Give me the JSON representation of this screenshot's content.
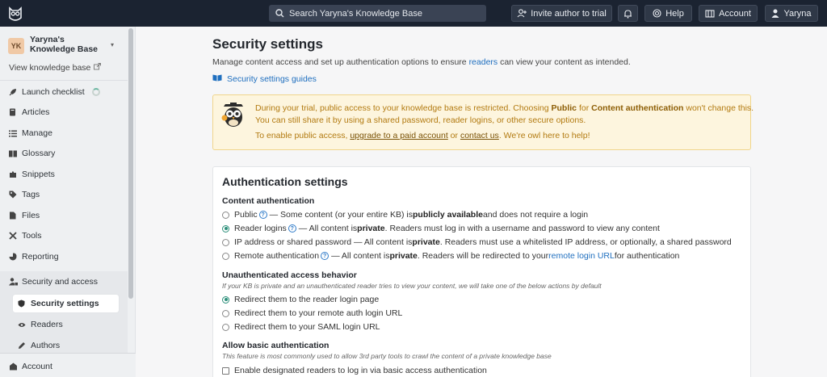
{
  "topbar": {
    "search_placeholder": "Search Yaryna's Knowledge Base",
    "invite_label": "Invite author to trial",
    "help_label": "Help",
    "account_label": "Account",
    "user_label": "Yaryna",
    "icons": [
      "owl-logo-icon",
      "search-icon",
      "add-user-icon",
      "bell-icon",
      "help-icon",
      "account-icon",
      "user-icon"
    ]
  },
  "sidebar": {
    "kb_initials": "YK",
    "kb_name": "Yaryna's Knowledge Base",
    "view_kb": "View knowledge base",
    "items": [
      {
        "label": "Launch checklist",
        "icon": "rocket-icon"
      },
      {
        "label": "Articles",
        "icon": "book-icon"
      },
      {
        "label": "Manage",
        "icon": "list-icon"
      },
      {
        "label": "Glossary",
        "icon": "glossary-icon"
      },
      {
        "label": "Snippets",
        "icon": "puzzle-icon"
      },
      {
        "label": "Tags",
        "icon": "tag-icon"
      },
      {
        "label": "Files",
        "icon": "file-icon"
      },
      {
        "label": "Tools",
        "icon": "tools-icon"
      },
      {
        "label": "Reporting",
        "icon": "chart-icon"
      }
    ],
    "section": {
      "label": "Security and access",
      "subitems": [
        {
          "label": "Security settings",
          "active": true
        },
        {
          "label": "Readers",
          "active": false
        },
        {
          "label": "Authors",
          "active": false
        }
      ]
    },
    "footer_account": "Account"
  },
  "main": {
    "title": "Security settings",
    "desc_before": "Manage content access and set up authentication options to ensure ",
    "desc_link": "readers",
    "desc_after": " can view your content as intended.",
    "guides_label": "Security settings guides",
    "notice": {
      "l1a": "During your trial, public access to your knowledge base is restricted. Choosing ",
      "l1b": "Public",
      "l1c": " for ",
      "l1d": "Content authentication",
      "l1e": " won't change this.",
      "l2": "You can still share it by using a shared password, reader logins, or other secure options.",
      "l3a": "To enable public access, ",
      "l3b": "upgrade to a paid account",
      "l3c": " or ",
      "l3d": "contact us",
      "l3e": ". We're owl here to help!"
    },
    "card": {
      "title": "Authentication settings",
      "content_auth_title": "Content authentication",
      "opt_public_a": "Public",
      "opt_public_b": " — Some content (or your entire KB) is ",
      "opt_public_c": "publicly available",
      "opt_public_d": " and does not require a login",
      "opt_reader_a": "Reader logins",
      "opt_reader_b": " — All content is ",
      "opt_reader_c": "private",
      "opt_reader_d": ". Readers must log in with a username and password to view any content",
      "opt_ip_a": "IP address or shared password — All content is ",
      "opt_ip_b": "private",
      "opt_ip_c": ". Readers must use a whitelisted IP address, or optionally, a shared password",
      "opt_remote_a": "Remote authentication",
      "opt_remote_b": " — All content is ",
      "opt_remote_c": "private",
      "opt_remote_d": ". Readers will be redirected to your ",
      "opt_remote_link": "remote login URL",
      "opt_remote_e": " for authentication",
      "unauth_title": "Unauthenticated access behavior",
      "unauth_note": "If your KB is private and an unauthenticated reader tries to view your content, we will take one of the below actions by default",
      "unauth_opts": [
        "Redirect them to the reader login page",
        "Redirect them to your remote auth login URL",
        "Redirect them to your SAML login URL"
      ],
      "basic_title": "Allow basic authentication",
      "basic_note": "This feature is most commonly used to allow 3rd party tools to crawl the content of a private knowledge base",
      "basic_opt": "Enable designated readers to log in via basic access authentication"
    }
  }
}
